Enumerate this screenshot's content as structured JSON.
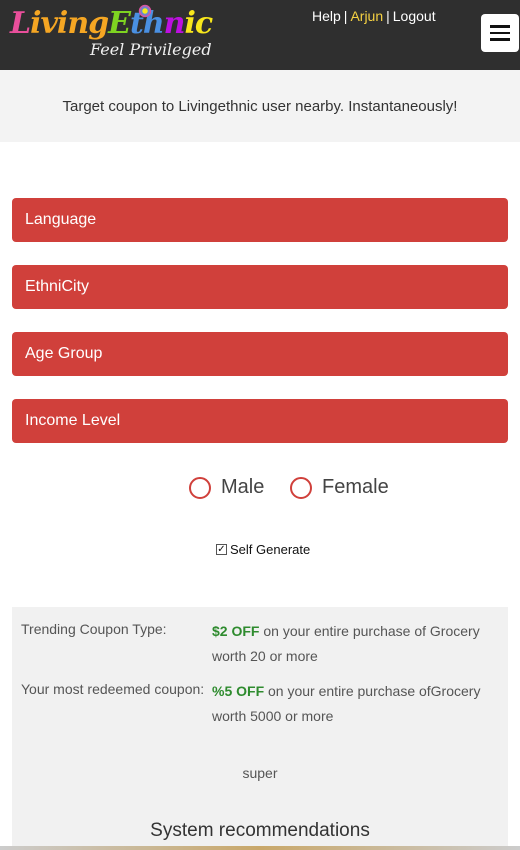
{
  "brand": {
    "logo_parts": [
      "L",
      "iving",
      "E",
      "th",
      "n",
      "ic"
    ],
    "tagline": "Feel Privileged"
  },
  "toplinks": {
    "help": "Help",
    "user": "Arjun",
    "logout": "Logout",
    "separator": "|"
  },
  "banner": {
    "text": "Target coupon to Livingethnic user nearby. Instantaneously!"
  },
  "filters": [
    {
      "label": "Language"
    },
    {
      "label": "EthniCity"
    },
    {
      "label": "Age Group"
    },
    {
      "label": "Income Level"
    }
  ],
  "gender": {
    "male": "Male",
    "female": "Female"
  },
  "self_generate": {
    "label": "Self Generate",
    "checked": true,
    "check_glyph": "✓"
  },
  "info": {
    "trending_label": "Trending Coupon Type:",
    "trending_offer": "$2 OFF",
    "trending_rest": " on your entire purchase of Grocery worth 20 or more",
    "redeemed_label": "Your most redeemed coupon:",
    "redeemed_offer": "%5 OFF",
    "redeemed_rest": " on your entire purchase ofGrocery worth 5000 or more",
    "note": "super",
    "recommendations_title": "System recommendations"
  },
  "colors": {
    "accent": "#d0403b",
    "offer_green": "#2e8b2e",
    "header_bg": "#2f2f2f"
  }
}
